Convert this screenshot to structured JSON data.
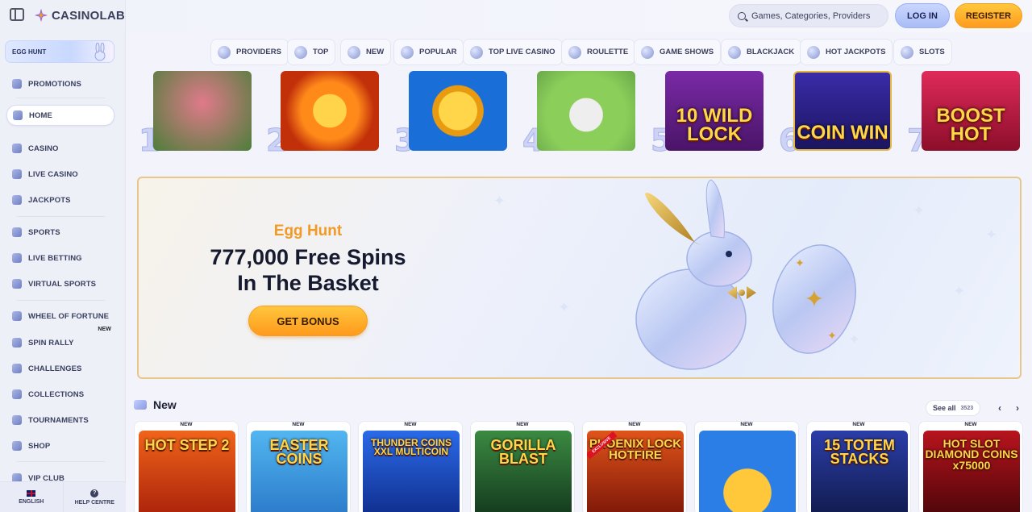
{
  "brand": {
    "name": "CASINOLAB"
  },
  "sidebar": {
    "egg_hunt_label": "EGG HUNT",
    "items": [
      {
        "label": "PROMOTIONS",
        "icon": "promotions-icon"
      },
      {
        "label": "HOME",
        "icon": "home-icon"
      },
      {
        "label": "CASINO",
        "icon": "casino-icon"
      },
      {
        "label": "LIVE CASINO",
        "icon": "live-casino-icon"
      },
      {
        "label": "JACKPOTS",
        "icon": "jackpots-icon"
      },
      {
        "label": "SPORTS",
        "icon": "sports-icon"
      },
      {
        "label": "LIVE BETTING",
        "icon": "live-betting-icon"
      },
      {
        "label": "VIRTUAL SPORTS",
        "icon": "virtual-sports-icon"
      },
      {
        "label": "WHEEL OF FORTUNE",
        "icon": "wheel-icon"
      },
      {
        "label": "SPIN RALLY",
        "icon": "spin-rally-icon",
        "badge": "NEW"
      },
      {
        "label": "CHALLENGES",
        "icon": "challenges-icon"
      },
      {
        "label": "COLLECTIONS",
        "icon": "collections-icon"
      },
      {
        "label": "TOURNAMENTS",
        "icon": "trophy-icon"
      },
      {
        "label": "SHOP",
        "icon": "shop-icon"
      },
      {
        "label": "VIP CLUB",
        "icon": "vip-icon"
      }
    ],
    "active": "HOME",
    "footer": {
      "language": "ENGLISH",
      "help": "HELP CENTRE"
    }
  },
  "header": {
    "search_placeholder": "Games, Categories, Providers",
    "login_label": "LOG IN",
    "register_label": "REGISTER"
  },
  "categories": [
    "PROVIDERS",
    "TOP",
    "NEW",
    "POPULAR",
    "TOP LIVE CASINO",
    "ROULETTE",
    "GAME SHOWS",
    "BLACKJACK",
    "HOT JACKPOTS",
    "SLOTS"
  ],
  "top_games": [
    {
      "rank": "1",
      "title": "",
      "bg": "#7fbf6a"
    },
    {
      "rank": "2",
      "title": "",
      "bg": "#e05a12"
    },
    {
      "rank": "3",
      "title": "",
      "bg": "#1e6fd6"
    },
    {
      "rank": "4",
      "title": "",
      "bg": "#8ccf5a"
    },
    {
      "rank": "5",
      "title": "10 WILD LOCK",
      "bg": "#5a1d7a"
    },
    {
      "rank": "6",
      "title": "COIN WIN",
      "bg": "#2a1f8c"
    },
    {
      "rank": "7",
      "title": "BOOST HOT",
      "bg": "#c8163c"
    }
  ],
  "banner": {
    "subtitle": "Egg Hunt",
    "title_line1": "777,000 Free Spins",
    "title_line2": "In The Basket",
    "cta": "GET BONUS"
  },
  "new_section": {
    "title": "New",
    "see_all": "See all",
    "count": "3523",
    "badge": "NEW",
    "games": [
      {
        "title": "HOT STEP 2",
        "bg": "#d8360f"
      },
      {
        "title": "EASTER COINS",
        "bg": "#3aa4e8"
      },
      {
        "title": "THUNDER COINS XXL MULTICOIN",
        "bg": "#1b4fd0"
      },
      {
        "title": "GORILLA BLAST",
        "bg": "#1f5a2e"
      },
      {
        "title": "PHOENIX LOCK HOTFIRE",
        "bg": "#b42a12",
        "exclusive": "EXCLUSIVE"
      },
      {
        "title": "",
        "bg": "#2a7ee6"
      },
      {
        "title": "15 TOTEM STACKS",
        "bg": "#1c2c78"
      },
      {
        "title": "HOT SLOT DIAMOND COINS x75000",
        "bg": "#7a0f14"
      }
    ]
  }
}
